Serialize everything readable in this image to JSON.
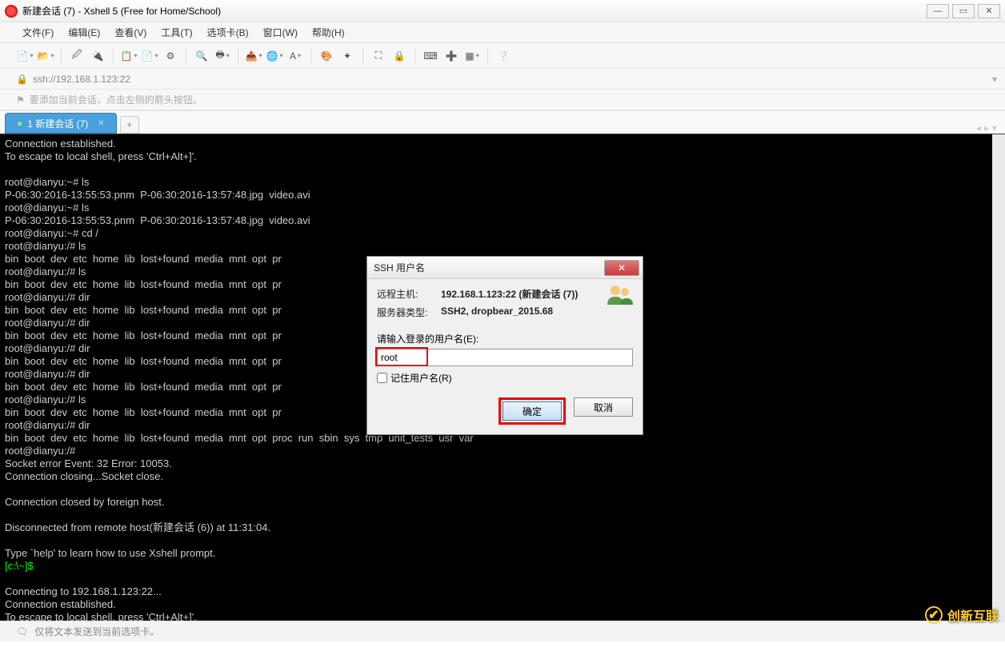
{
  "window": {
    "title": "新建会话 (7) - Xshell 5 (Free for Home/School)"
  },
  "menus": [
    "文件(F)",
    "编辑(E)",
    "查看(V)",
    "工具(T)",
    "选项卡(B)",
    "窗口(W)",
    "帮助(H)"
  ],
  "address": {
    "url": "ssh://192.168.1.123:22"
  },
  "hint": "要添加当前会话，点击左侧的箭头按钮。",
  "tab": {
    "label": "1 新建会话 (7)"
  },
  "terminal": {
    "lines": [
      "Connection established.",
      "To escape to local shell, press 'Ctrl+Alt+]'.",
      "",
      "root@dianyu:~# ls",
      "P-06:30:2016-13:55:53.pnm  P-06:30:2016-13:57:48.jpg  video.avi",
      "root@dianyu:~# ls",
      "P-06:30:2016-13:55:53.pnm  P-06:30:2016-13:57:48.jpg  video.avi",
      "root@dianyu:~# cd /",
      "root@dianyu:/# ls",
      "bin  boot  dev  etc  home  lib  lost+found  media  mnt  opt  pr",
      "root@dianyu:/# ls",
      "bin  boot  dev  etc  home  lib  lost+found  media  mnt  opt  pr",
      "root@dianyu:/# dir",
      "bin  boot  dev  etc  home  lib  lost+found  media  mnt  opt  pr",
      "root@dianyu:/# dir",
      "bin  boot  dev  etc  home  lib  lost+found  media  mnt  opt  pr",
      "root@dianyu:/# dir",
      "bin  boot  dev  etc  home  lib  lost+found  media  mnt  opt  pr",
      "root@dianyu:/# dir",
      "bin  boot  dev  etc  home  lib  lost+found  media  mnt  opt  pr",
      "root@dianyu:/# ls",
      "bin  boot  dev  etc  home  lib  lost+found  media  mnt  opt  pr",
      "root@dianyu:/# dir",
      "bin  boot  dev  etc  home  lib  lost+found  media  mnt  opt  proc  run  sbin  sys  tmp  unit_tests  usr  var",
      "root@dianyu:/#",
      "Socket error Event: 32 Error: 10053.",
      "Connection closing...Socket close.",
      "",
      "Connection closed by foreign host.",
      "",
      "Disconnected from remote host(新建会话 (6)) at 11:31:04.",
      "",
      "Type `help' to learn how to use Xshell prompt."
    ],
    "prompt": "[c:\\~]$ ",
    "footer": [
      "",
      "Connecting to 192.168.1.123:22...",
      "Connection established.",
      "To escape to local shell, press 'Ctrl+Alt+]'."
    ]
  },
  "dialog": {
    "title": "SSH 用户名",
    "remote_label": "远程主机:",
    "remote_value": "192.168.1.123:22 (新建会话 (7))",
    "server_label": "服务器类型:",
    "server_value": "SSH2, dropbear_2015.68",
    "prompt": "请输入登录的用户名(E):",
    "username": "root",
    "remember": "记住用户名(R)",
    "ok": "确定",
    "cancel": "取消"
  },
  "status": "仅将文本发送到当前选项卡。",
  "watermark": "创新互联"
}
